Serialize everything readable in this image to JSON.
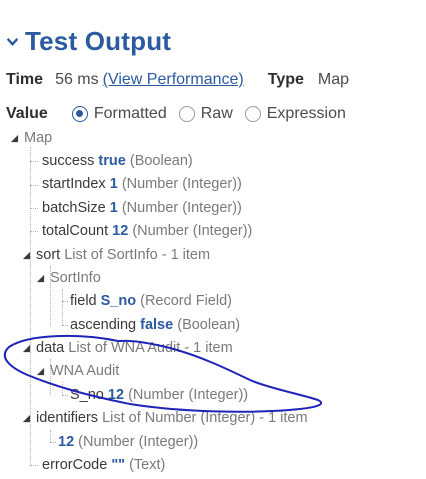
{
  "header": {
    "title": "Test Output",
    "toggle_icon": "chevron-down-icon"
  },
  "meta": {
    "time_label": "Time",
    "time_value": "56 ms",
    "perf_link": "(View Performance)",
    "type_label": "Type",
    "type_value": "Map"
  },
  "value": {
    "label": "Value",
    "options": [
      "Formatted",
      "Raw",
      "Expression"
    ],
    "selected": "Formatted"
  },
  "tree": {
    "root": "Map",
    "success": {
      "key": "success",
      "value": "true",
      "type": "(Boolean)"
    },
    "startIndex": {
      "key": "startIndex",
      "value": "1",
      "type": "(Number (Integer))"
    },
    "batchSize": {
      "key": "batchSize",
      "value": "1",
      "type": "(Number (Integer))"
    },
    "totalCount": {
      "key": "totalCount",
      "value": "12",
      "type": "(Number (Integer))"
    },
    "sort": {
      "key": "sort",
      "type": "List of SortInfo - 1 item"
    },
    "sortinfo": "SortInfo",
    "field": {
      "key": "field",
      "value": "S_no",
      "type": "(Record Field)"
    },
    "ascending": {
      "key": "ascending",
      "value": "false",
      "type": "(Boolean)"
    },
    "data": {
      "key": "data",
      "type": "List of WNA Audit - 1 item"
    },
    "wna": "WNA Audit",
    "sno": {
      "key": "S_no",
      "value": "12",
      "type": "(Number (Integer))"
    },
    "identifiers": {
      "key": "identifiers",
      "type": "List of Number (Integer) - 1 item"
    },
    "ident_item": {
      "value": "12",
      "type": "(Number (Integer))"
    },
    "errorCode": {
      "key": "errorCode",
      "value": "\"\"",
      "type": "(Text)"
    }
  },
  "colors": {
    "accent": "#2b5aa1",
    "annotation": "#1f24b8"
  }
}
